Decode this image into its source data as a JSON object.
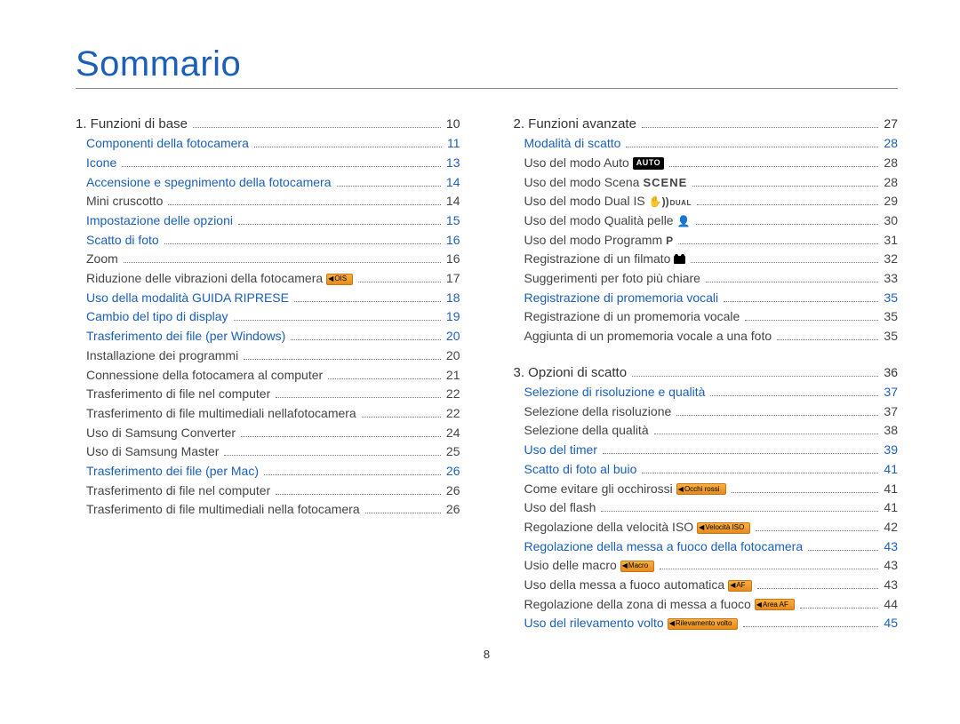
{
  "title": "Sommario",
  "page_number": "8",
  "left": [
    {
      "type": "section",
      "label": "1. Funzioni di base",
      "page": "10"
    },
    {
      "type": "blue",
      "label": "Componenti della fotocamera",
      "page": "11"
    },
    {
      "type": "blue",
      "label": "Icone",
      "page": "13"
    },
    {
      "type": "blue",
      "label": "Accensione e spegnimento della fotocamera",
      "page": "14"
    },
    {
      "type": "plain",
      "label": "Mini cruscotto",
      "page": "14"
    },
    {
      "type": "blue",
      "label": "Impostazione delle opzioni",
      "page": "15"
    },
    {
      "type": "blue",
      "label": "Scatto di foto",
      "page": "16"
    },
    {
      "type": "plain",
      "label": "Zoom",
      "page": "16"
    },
    {
      "type": "plain",
      "label": "Riduzione delle vibrazioni della fotocamera",
      "page": "17",
      "badge": "OIS"
    },
    {
      "type": "blue",
      "label": "Uso della modalità GUIDA RIPRESE",
      "page": "18"
    },
    {
      "type": "blue",
      "label": "Cambio del tipo di display",
      "page": "19"
    },
    {
      "type": "blue",
      "label": "Trasferimento dei file (per Windows)",
      "page": "20"
    },
    {
      "type": "plain",
      "label": "Installazione dei programmi",
      "page": "20"
    },
    {
      "type": "plain",
      "label": "Connessione della fotocamera al computer",
      "page": "21"
    },
    {
      "type": "plain",
      "label": "Trasferimento di file nel computer",
      "page": "22"
    },
    {
      "type": "plain",
      "label": "Trasferimento di file multimediali nellafotocamera",
      "page": "22"
    },
    {
      "type": "plain",
      "label": "Uso di Samsung Converter",
      "page": "24"
    },
    {
      "type": "plain",
      "label": "Uso di Samsung Master",
      "page": "25"
    },
    {
      "type": "blue",
      "label": "Trasferimento dei file (per Mac)",
      "page": "26"
    },
    {
      "type": "plain",
      "label": "Trasferimento di file nel computer",
      "page": "26"
    },
    {
      "type": "plain",
      "label": "Trasferimento di file multimediali nella fotocamera",
      "page": "26"
    }
  ],
  "right": [
    {
      "type": "section",
      "label": "2. Funzioni avanzate",
      "page": "27"
    },
    {
      "type": "blue",
      "label": "Modalità di scatto",
      "page": "28"
    },
    {
      "type": "plain",
      "label": "Uso del modo Auto",
      "page": "28",
      "icon": "auto"
    },
    {
      "type": "plain",
      "label": "Uso del modo Scena",
      "page": "28",
      "icon": "scene"
    },
    {
      "type": "plain",
      "label": "Uso del modo Dual IS",
      "page": "29",
      "icon": "dual"
    },
    {
      "type": "plain",
      "label": "Uso del modo Qualità pelle",
      "page": "30",
      "icon": "face"
    },
    {
      "type": "plain",
      "label": "Uso del modo Programm",
      "page": "31",
      "icon": "p"
    },
    {
      "type": "plain",
      "label": "Registrazione di un filmato",
      "page": "32",
      "icon": "film"
    },
    {
      "type": "plain",
      "label": "Suggerimenti per foto più chiare",
      "page": "33"
    },
    {
      "type": "blue",
      "label": "Registrazione di promemoria vocali",
      "page": "35"
    },
    {
      "type": "plain",
      "label": "Registrazione di un promemoria vocale",
      "page": "35"
    },
    {
      "type": "plain",
      "label": "Aggiunta di un promemoria vocale a una foto",
      "page": "35"
    },
    {
      "type": "spacer"
    },
    {
      "type": "section",
      "label": "3. Opzioni di scatto",
      "page": "36"
    },
    {
      "type": "blue",
      "label": "Selezione di risoluzione e qualità",
      "page": "37"
    },
    {
      "type": "plain",
      "label": "Selezione della risoluzione",
      "page": "37"
    },
    {
      "type": "plain",
      "label": "Selezione della qualità",
      "page": "38"
    },
    {
      "type": "blue",
      "label": "Uso del timer",
      "page": "39"
    },
    {
      "type": "blue",
      "label": "Scatto di foto al buio",
      "page": "41"
    },
    {
      "type": "plain",
      "label": "Come evitare gli occhirossi",
      "page": "41",
      "badge": "Occhi rossi"
    },
    {
      "type": "plain",
      "label": "Uso del flash",
      "page": "41"
    },
    {
      "type": "plain",
      "label": "Regolazione della velocità ISO",
      "page": "42",
      "badge": "Velocità ISO"
    },
    {
      "type": "blue",
      "label": "Regolazione della messa a fuoco della fotocamera",
      "page": "43"
    },
    {
      "type": "plain",
      "label": "Usio delle macro",
      "page": "43",
      "badge": "Macro"
    },
    {
      "type": "plain",
      "label": "Uso della messa a fuoco automatica",
      "page": "43",
      "badge": "AF"
    },
    {
      "type": "plain",
      "label": "Regolazione della zona di messa a fuoco",
      "page": "44",
      "badge": "Area AF"
    },
    {
      "type": "blue",
      "label": "Uso del rilevamento volto",
      "page": "45",
      "badge": "Rilevamento volto"
    }
  ]
}
